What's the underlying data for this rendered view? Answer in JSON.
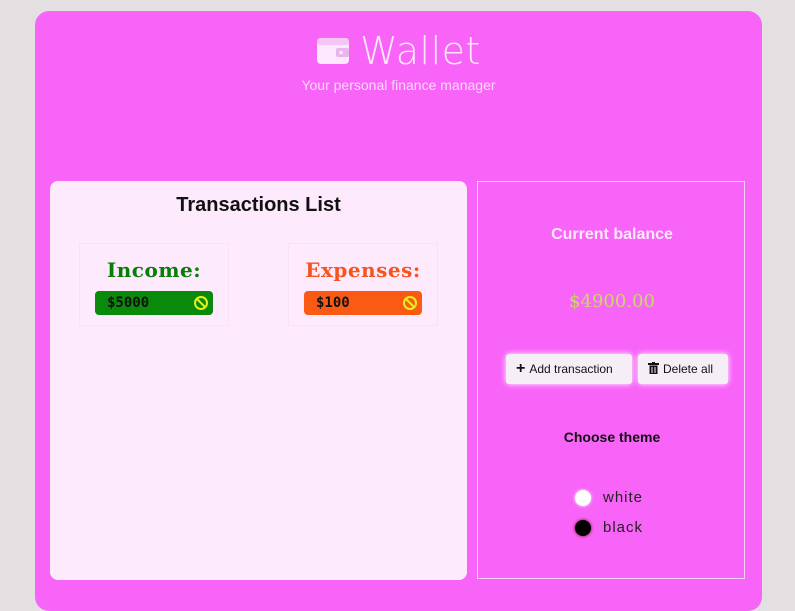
{
  "header": {
    "title": "Wallet",
    "subtitle": "Your personal finance manager",
    "icon": "wallet-icon"
  },
  "transactions": {
    "title": "Transactions List",
    "income": {
      "label": "Income:",
      "amount": "$5000"
    },
    "expenses": {
      "label": "Expenses:",
      "amount": "$100"
    }
  },
  "balance": {
    "title": "Current balance",
    "value": "$4900.00"
  },
  "actions": {
    "add_label": "Add transaction",
    "delete_label": "Delete all"
  },
  "theme": {
    "title": "Choose theme",
    "options": [
      "white",
      "black"
    ]
  },
  "colors": {
    "background": "#f864f8",
    "income": "#0a8a0a",
    "expense": "#fb5a15",
    "balance": "#c9d66a"
  }
}
